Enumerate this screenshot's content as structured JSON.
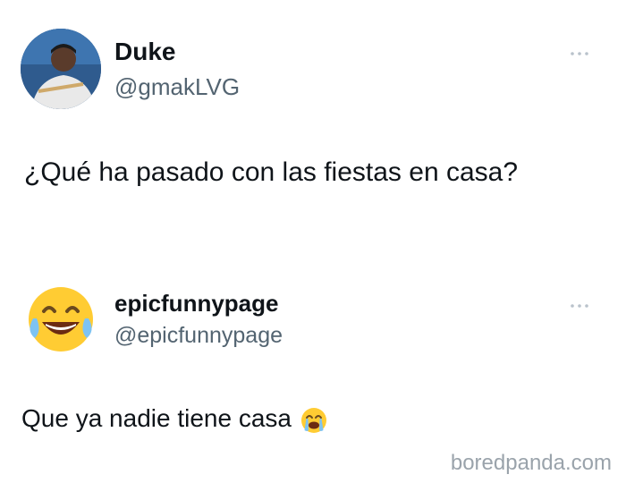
{
  "tweet1": {
    "display_name": "Duke",
    "handle": "@gmakLVG",
    "more_icon": "more-dots-icon",
    "text": "¿Qué ha pasado con las fiestas en casa?"
  },
  "tweet2": {
    "display_name": "epicfunnypage",
    "handle": "@epicfunnypage",
    "avatar_icon": "tears-of-joy-emoji",
    "more_icon": "more-dots-icon",
    "text": "Que ya nadie tiene casa",
    "inline_emoji": "loudly-crying-emoji"
  },
  "watermark": "boredpanda.com",
  "colors": {
    "text": "#0f1419",
    "secondary": "#536471",
    "watermark": "#9aa3ab"
  }
}
